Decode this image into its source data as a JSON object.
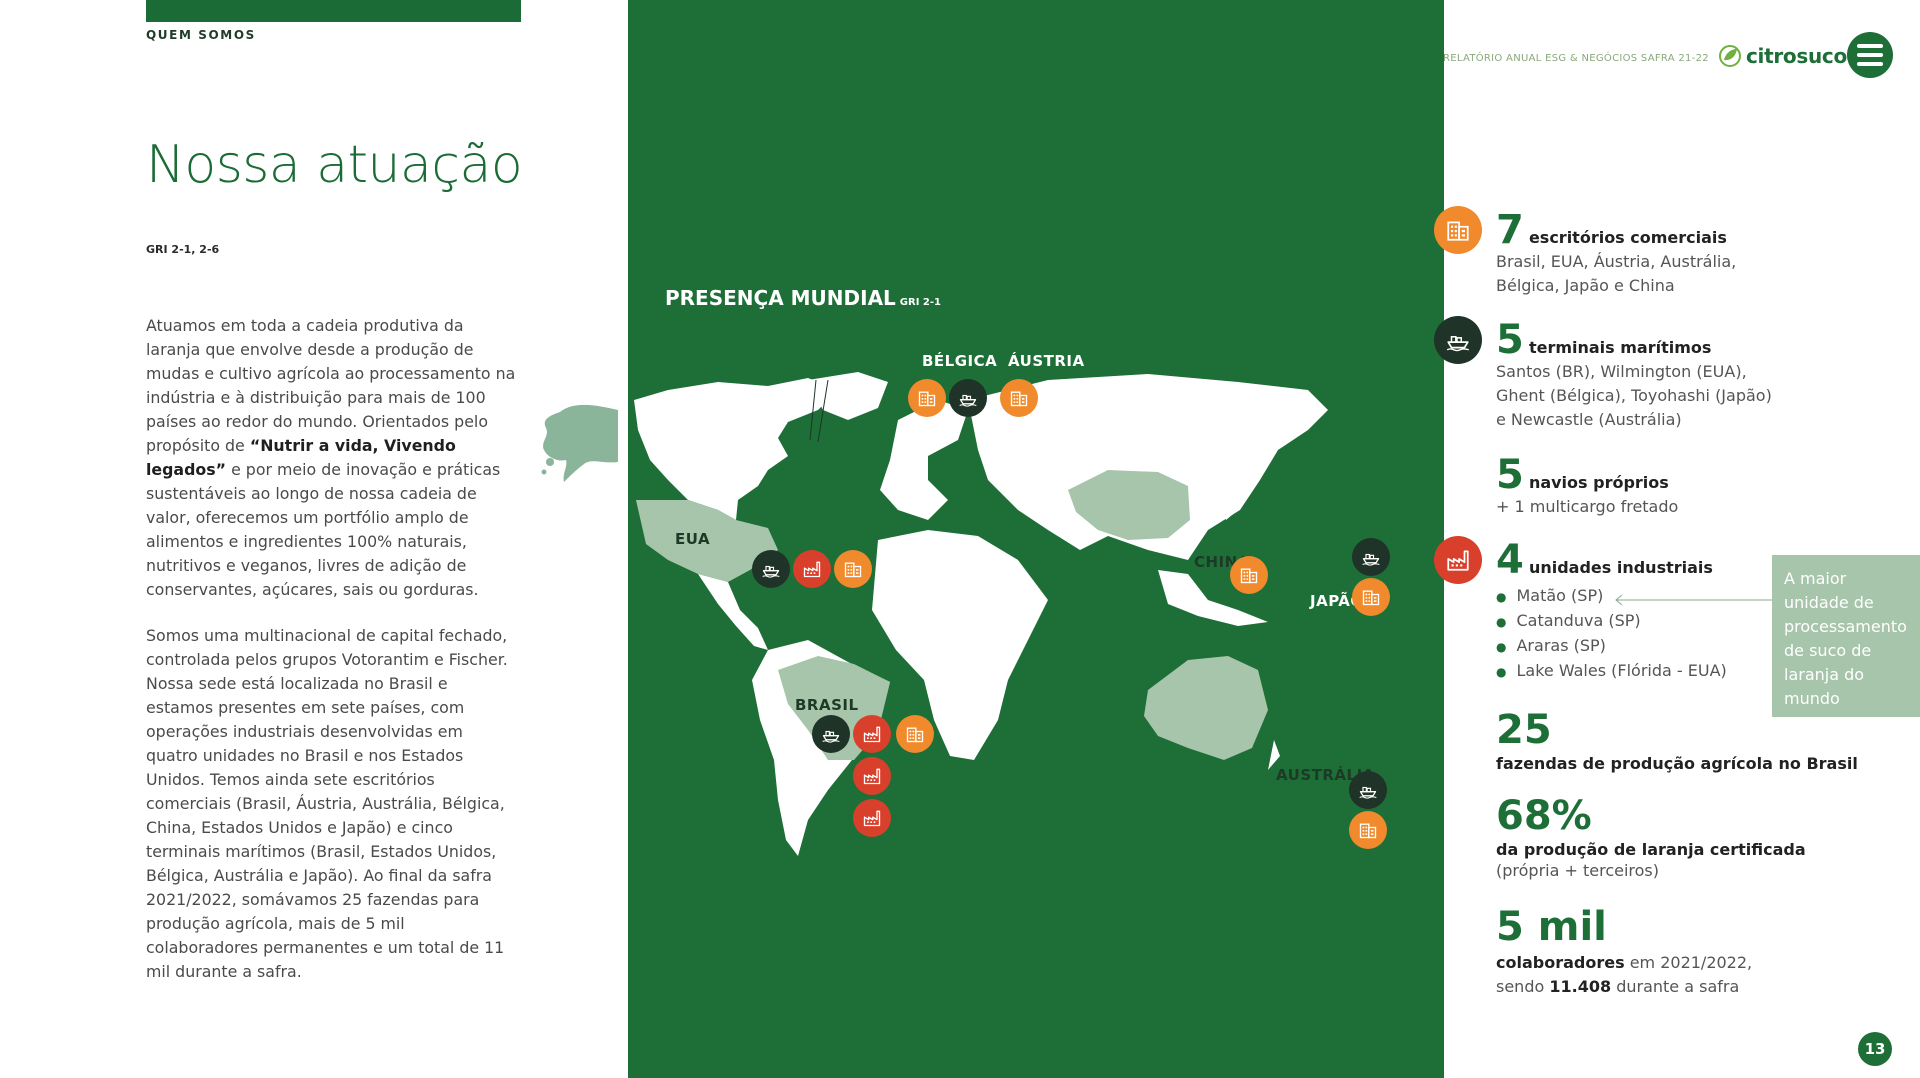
{
  "header": {
    "section": "QUEM SOMOS",
    "report_title": "RELATÓRIO ANUAL ESG & NEGÓCIOS  SAFRA 21-22",
    "brand": "citrosuco"
  },
  "page": {
    "title": "Nossa atuação",
    "gri": "GRI 2-1, 2-6",
    "paragraph1_before": "Atuamos em toda a cadeia produtiva da laranja que envolve desde a produção de mudas e cultivo agrícola ao processamento na indústria e à distribuição para mais de 100 países ao redor do mundo. Orientados pelo propósito de ",
    "paragraph1_bold": "“Nutrir a vida, Vivendo legados”",
    "paragraph1_after": " e por meio de inovação e práticas sustentáveis ao longo de nossa cadeia de valor, oferecemos um portfólio amplo de alimentos e ingredientes 100% naturais, nutritivos e veganos, livres de adição de conservantes, açúcares, sais ou gorduras.",
    "paragraph2": "Somos uma multinacional de capital fechado, controlada pelos grupos Votorantim e Fischer. Nossa sede está localizada no Brasil e estamos presentes em sete países, com operações industriais desenvolvidas em quatro unidades no Brasil e nos Estados Unidos. Temos ainda sete escritórios comerciais (Brasil, Áustria, Austrália, Bélgica, China, Estados Unidos e Japão) e cinco terminais marítimos (Brasil, Estados Unidos, Bélgica, Austrália e Japão). Ao final da safra 2021/2022, somávamos 25 fazendas para produção agrícola, mais de 5 mil colaboradores permanentes e um total de 11 mil durante a safra.",
    "page_number": "13"
  },
  "map": {
    "title": "PRESENÇA MUNDIAL",
    "title_sub": "GRI 2-1",
    "labels": {
      "belgica": "BÉLGICA",
      "austria": "ÁUSTRIA",
      "eua": "EUA",
      "china": "CHINA",
      "japao": "JAPÃO",
      "brasil": "BRASIL",
      "australia": "AUSTRÁLIA"
    }
  },
  "stats": {
    "offices": {
      "num": "7",
      "label": "escritórios comerciais",
      "detail1": "Brasil, EUA, Áustria, Austrália,",
      "detail2": "Bélgica, Japão e China"
    },
    "terminals": {
      "num": "5",
      "label": "terminais marítimos",
      "detail1": "Santos (BR), Wilmington (EUA),",
      "detail2": "Ghent (Bélgica), Toyohashi (Japão)",
      "detail3": "e Newcastle (Austrália)"
    },
    "ships": {
      "num": "5",
      "label": "navios próprios",
      "detail": "+ 1 multicargo fretado"
    },
    "plants": {
      "num": "4",
      "label": "unidades industriais",
      "items": [
        "Matão (SP)",
        "Catanduva (SP)",
        "Araras (SP)",
        "Lake Wales (Flórida - EUA)"
      ]
    },
    "callout": "A maior unidade de processamento de suco de laranja do mundo",
    "farms": {
      "num": "25",
      "label": "fazendas de produção agrícola no Brasil"
    },
    "certified": {
      "num": "68%",
      "label": "da produção de laranja certificada",
      "detail": "(própria + terceiros)"
    },
    "employees": {
      "num": "5 mil",
      "label_bold": "colaboradores",
      "label_rest": " em 2021/2022,",
      "detail_before": "sendo ",
      "detail_bold": "11.408",
      "detail_after": " durante a safra"
    }
  },
  "colors": {
    "green": "#1e6e37",
    "light_green": "#a6c5aa",
    "orange": "#f08a2c",
    "red": "#d9402b",
    "dark": "#1f3328"
  },
  "icons": [
    "building-icon",
    "ship-icon",
    "factory-icon",
    "drop-icon",
    "menu-icon",
    "leaf-logo-icon"
  ]
}
